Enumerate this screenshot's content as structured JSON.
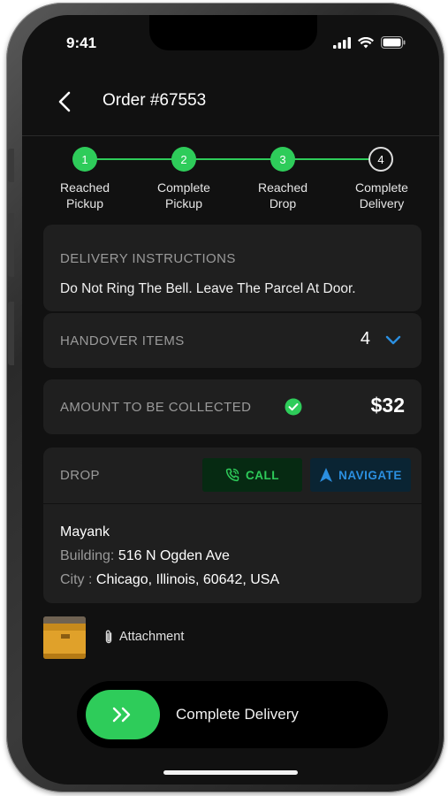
{
  "status_bar": {
    "time": "9:41"
  },
  "header": {
    "title": "Order #67553"
  },
  "stepper": {
    "steps": [
      {
        "number": "1",
        "label_line1": "Reached",
        "label_line2": "Pickup",
        "state": "done"
      },
      {
        "number": "2",
        "label_line1": "Complete",
        "label_line2": "Pickup",
        "state": "done"
      },
      {
        "number": "3",
        "label_line1": "Reached",
        "label_line2": "Drop",
        "state": "done"
      },
      {
        "number": "4",
        "label_line1": "Complete",
        "label_line2": "Delivery",
        "state": "pending"
      }
    ]
  },
  "instructions": {
    "label": "DELIVERY INSTRUCTIONS",
    "text": "Do Not Ring The Bell. Leave The Parcel At Door."
  },
  "handover": {
    "label": "HANDOVER ITEMS",
    "count": "4"
  },
  "amount": {
    "label": "AMOUNT TO BE COLLECTED",
    "value": "$32"
  },
  "drop": {
    "label": "DROP",
    "call_label": "CALL",
    "navigate_label": "NAVIGATE",
    "customer_name": "Mayank",
    "building_key": "Building:",
    "building_value": "516 N Ogden Ave",
    "city_key": "City :",
    "city_value": "Chicago, Illinois,  60642, USA"
  },
  "attachment": {
    "label": "Attachment"
  },
  "slider": {
    "label": "Complete Delivery"
  },
  "colors": {
    "accent_green": "#2ecc5a",
    "accent_blue": "#2b8fe0",
    "background": "#111111",
    "card": "#1f1f1f"
  },
  "icons": [
    "back-chevron-icon",
    "signal-icon",
    "wifi-icon",
    "battery-icon",
    "chevron-down-icon",
    "check-circle-icon",
    "phone-icon",
    "navigate-arrow-icon",
    "paperclip-icon",
    "double-chevron-right-icon"
  ]
}
